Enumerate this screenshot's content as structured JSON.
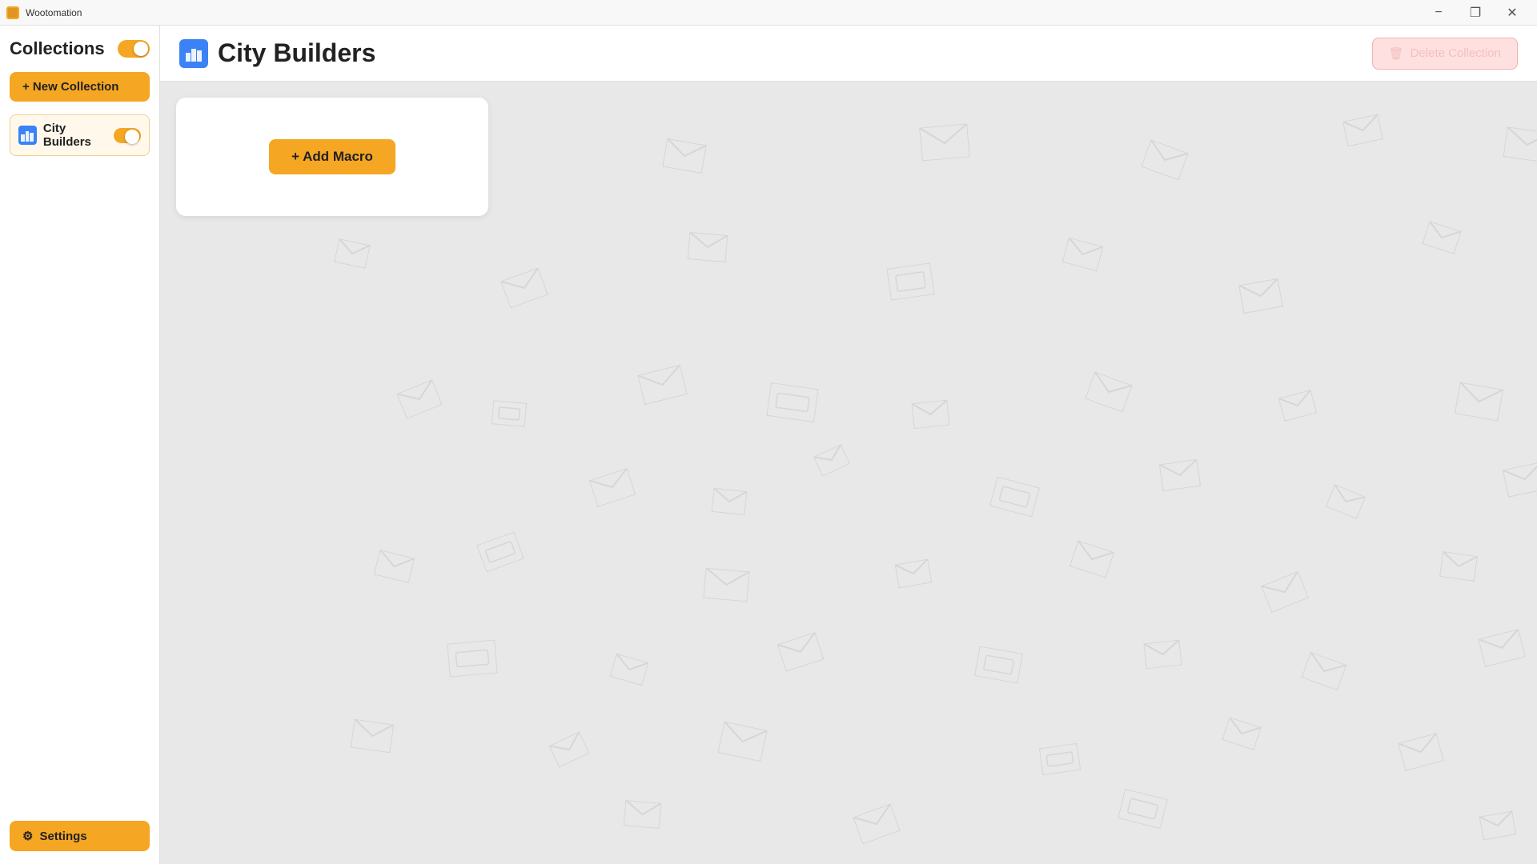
{
  "titlebar": {
    "app_name": "Wootomation",
    "min_label": "−",
    "restore_label": "❐",
    "close_label": "✕"
  },
  "sidebar": {
    "title": "Collections",
    "toggle_on": true,
    "new_collection_label": "+ New Collection",
    "collections": [
      {
        "id": "city-builders",
        "name": "City Builders",
        "icon": "🏙",
        "enabled": true
      }
    ],
    "settings_label": "Settings"
  },
  "header": {
    "collection_name": "City Builders",
    "delete_label": "Delete Collection"
  },
  "content": {
    "add_macro_label": "+ Add Macro"
  },
  "colors": {
    "accent": "#f5a623",
    "delete_bg": "#ffe0e0",
    "delete_text": "#c03030"
  }
}
